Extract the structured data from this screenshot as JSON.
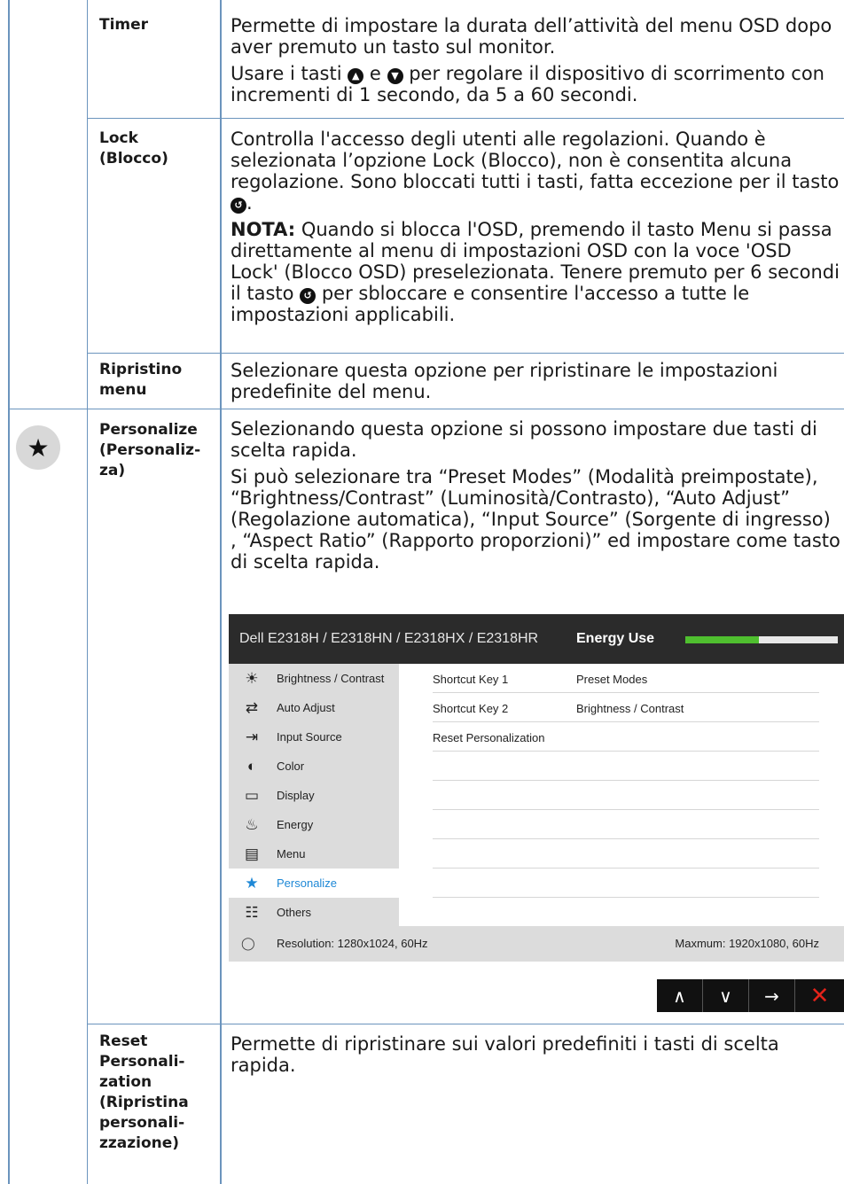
{
  "rows": {
    "timer": {
      "name": "Timer",
      "p1": "Permette di impostare la durata dell’attività del menu OSD dopo aver premuto un tasto sul monitor.",
      "p2_a": "Usare i tasti ",
      "p2_b": " e ",
      "p2_c": " per regolare il dispositivo di scorrimento con incrementi di 1 secondo, da 5 a 60 secondi."
    },
    "lock": {
      "name_1": "Lock",
      "name_2": "(Blocco)",
      "p1_a": "Controlla l'accesso degli utenti alle regolazioni. Quando è selezionata l’opzione Lock (Blocco), non è consentita alcuna regolazione. Sono bloccati tutti i tasti, fatta eccezione per il tasto ",
      "p1_b": ".",
      "note_label": "NOTA:",
      "note_a": " Quando si blocca l'OSD, premendo il tasto Menu si passa direttamente al menu di impostazioni OSD con la voce 'OSD Lock' (Blocco OSD) preselezionata. Tenere premuto per 6 secondi il tasto ",
      "note_b": " per sbloccare e consentire l'accesso a tutte le impostazioni applicabili."
    },
    "reset_menu": {
      "name_1": "Ripristino",
      "name_2": "menu",
      "p1": "Selezionare questa opzione per ripristinare le impostazioni predefinite del menu."
    },
    "personalize": {
      "name_1": "Personalize",
      "name_2": "(Personaliz-",
      "name_3": "za)",
      "p1": "Selezionando questa opzione si possono impostare due tasti di scelta rapida.",
      "p2": "Si può selezionare tra “Preset Modes” (Modalità preimpostate), “Brightness/Contrast” (Luminosità/Contrasto), “Auto Adjust” (Regolazione automatica), “Input Source” (Sorgente di ingresso) , “Aspect Ratio” (Rapporto proporzioni)” ed impostare come tasto di scelta rapida."
    },
    "reset_personalization": {
      "name_1": "Reset",
      "name_2": "Personali-",
      "name_3": "zation",
      "name_4": "(Ripristina",
      "name_5": "personali-",
      "name_6": "zzazione)",
      "p1": "Permette di ripristinare sui valori predefiniti i tasti di scelta rapida."
    }
  },
  "osd": {
    "model": "Dell E2318H / E2318HN / E2318HX / E2318HR",
    "energy_label": "Energy Use",
    "energy_level": 0.48,
    "menu": [
      {
        "icon": "brightness-icon",
        "glyph": "☀",
        "label": "Brightness / Contrast"
      },
      {
        "icon": "auto-adjust-icon",
        "glyph": "⇄",
        "label": "Auto Adjust"
      },
      {
        "icon": "input-source-icon",
        "glyph": "⇥",
        "label": "Input Source"
      },
      {
        "icon": "color-icon",
        "glyph": "◐",
        "label": "Color"
      },
      {
        "icon": "display-icon",
        "glyph": "▭",
        "label": "Display"
      },
      {
        "icon": "energy-icon",
        "glyph": "♨",
        "label": "Energy"
      },
      {
        "icon": "menu-icon",
        "glyph": "▤",
        "label": "Menu"
      },
      {
        "icon": "star-icon",
        "glyph": "★",
        "label": "Personalize"
      },
      {
        "icon": "others-icon",
        "glyph": "☷",
        "label": "Others"
      }
    ],
    "panel": [
      {
        "label": "Shortcut Key 1",
        "value": "Preset Modes"
      },
      {
        "label": "Shortcut Key 2",
        "value": "Brightness / Contrast"
      },
      {
        "label": "Reset Personalization",
        "value": ""
      },
      {
        "label": "",
        "value": ""
      },
      {
        "label": "",
        "value": ""
      },
      {
        "label": "",
        "value": ""
      },
      {
        "label": "",
        "value": ""
      },
      {
        "label": "",
        "value": ""
      }
    ],
    "resolution": "Resolution: 1280x1024, 60Hz",
    "maximum": "Maxmum: 1920x1080, 60Hz",
    "nav": [
      "∧",
      "∨",
      "→",
      "✕"
    ]
  },
  "glyphs": {
    "up_btn": "▲",
    "down_btn": "▼",
    "back_btn": "↺",
    "star": "★"
  }
}
